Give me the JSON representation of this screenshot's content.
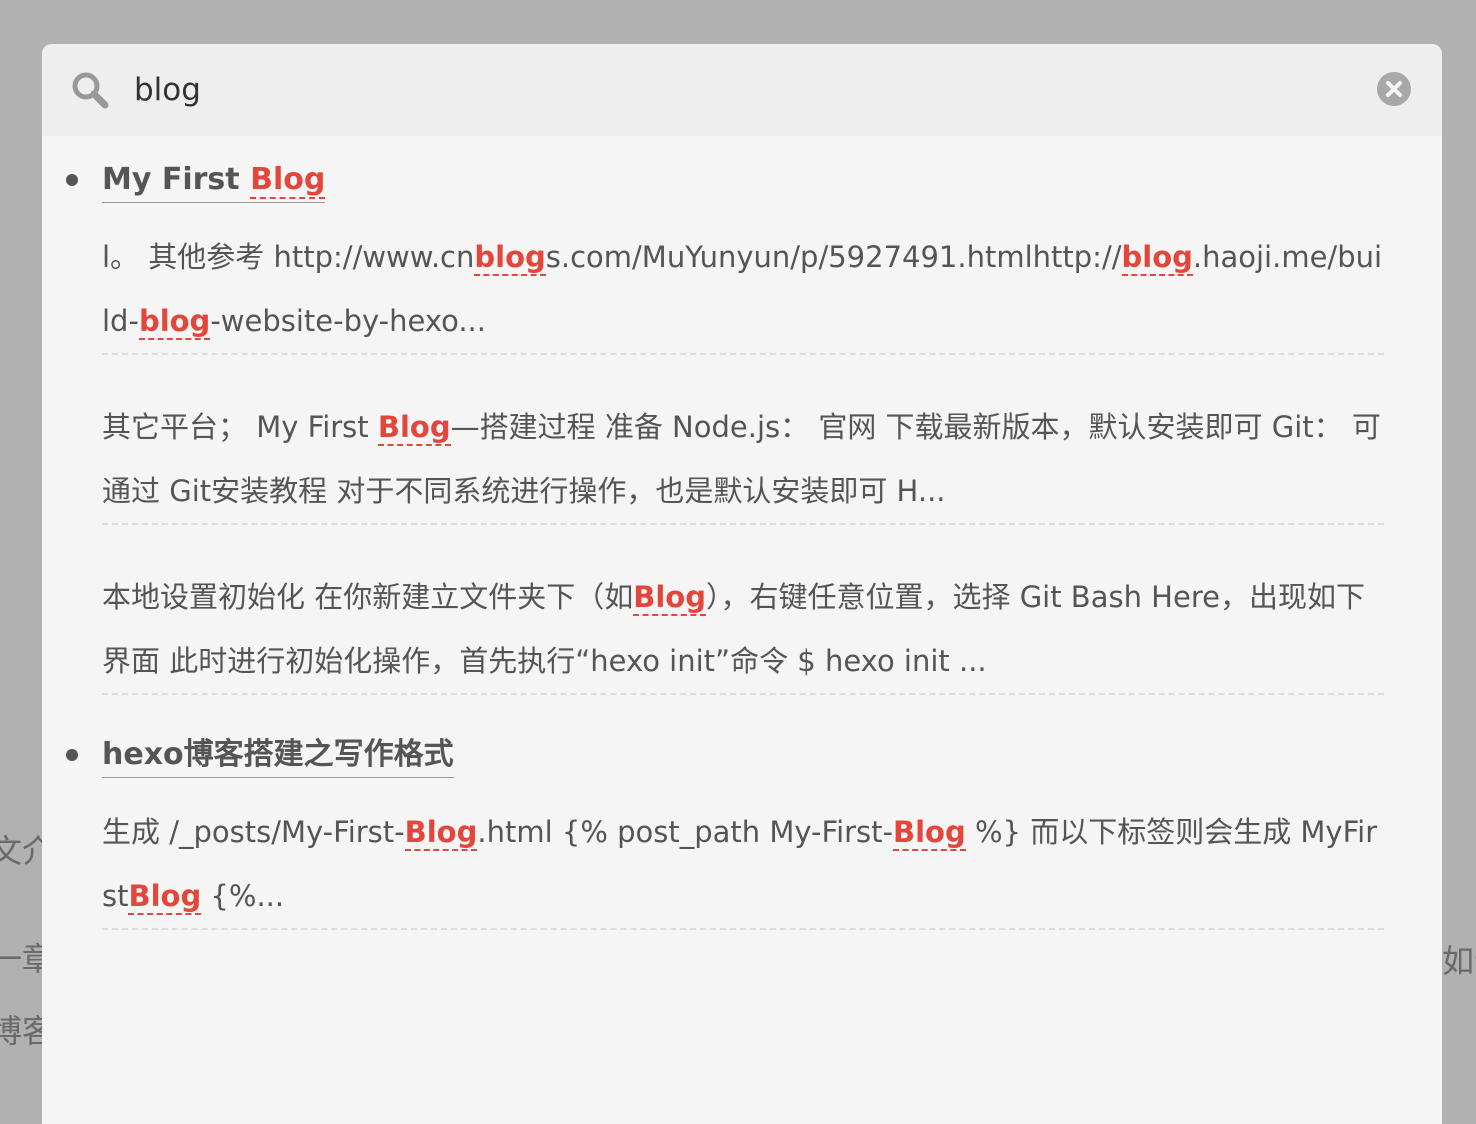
{
  "background": {
    "left_lines": [
      "文介",
      "一章",
      "博客"
    ],
    "right_lines": [
      "如何"
    ]
  },
  "search": {
    "query": "blog",
    "placeholder": ""
  },
  "colors": {
    "highlight": "#e3473c",
    "text": "#555555",
    "overlay": "#b1b1b1",
    "panel": "#f5f5f5"
  },
  "icons": {
    "search": "search-icon",
    "clear": "close-circle-icon",
    "bullet": "bullet-icon"
  },
  "results": [
    {
      "title": [
        {
          "t": "My First "
        },
        {
          "t": "Blog",
          "hl": true
        }
      ],
      "excerpts": [
        [
          {
            "t": "l。 其他参考 http://www.cn"
          },
          {
            "t": "blog",
            "hl": true
          },
          {
            "t": "s.com/MuYunyun/p/5927491.htmlhttp://"
          },
          {
            "t": "blog",
            "hl": true
          },
          {
            "t": ".haoji.me/build-"
          },
          {
            "t": "blog",
            "hl": true
          },
          {
            "t": "-website-by-hexo..."
          }
        ],
        [
          {
            "t": "其它平台； My First "
          },
          {
            "t": "Blog",
            "hl": true
          },
          {
            "t": "—搭建过程 准备 Node.js： 官网 下载最新版本，默认安装即可 Git： 可通过 Git安装教程 对于不同系统进行操作，也是默认安装即可 H..."
          }
        ],
        [
          {
            "t": "本地设置初始化 在你新建立文件夹下（如"
          },
          {
            "t": "Blog",
            "hl": true
          },
          {
            "t": "），右键任意位置，选择 Git Bash Here，出现如下界面 此时进行初始化操作，首先执行“hexo init”命令 $ hexo init ..."
          }
        ]
      ]
    },
    {
      "title": [
        {
          "t": "hexo博客搭建之写作格式"
        }
      ],
      "excerpts": [
        [
          {
            "t": "生成 /_posts/My-First-"
          },
          {
            "t": "Blog",
            "hl": true
          },
          {
            "t": ".html {% post_path My-First-"
          },
          {
            "t": "Blog",
            "hl": true
          },
          {
            "t": " %} 而以下标签则会生成 MyFirst"
          },
          {
            "t": "Blog",
            "hl": true
          },
          {
            "t": " {%..."
          }
        ]
      ]
    }
  ]
}
